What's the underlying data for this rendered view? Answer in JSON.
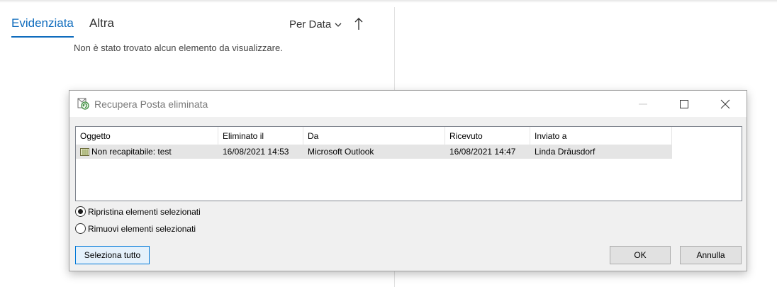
{
  "tabs": {
    "featured": "Evidenziata",
    "other": "Altra"
  },
  "sort": {
    "label": "Per Data"
  },
  "empty_message": "Non è stato trovato alcun elemento da visualizzare.",
  "dialog": {
    "title": "Recupera Posta eliminata",
    "columns": [
      "Oggetto",
      "Eliminato il",
      "Da",
      "Ricevuto",
      "Inviato a"
    ],
    "rows": [
      {
        "subject": "Non recapitabile: test",
        "deleted_on": "16/08/2021 14:53",
        "from": "Microsoft Outlook",
        "received": "16/08/2021 14:47",
        "sent_to": "Linda Dräusdorf"
      }
    ],
    "options": {
      "restore": "Ripristina elementi selezionati",
      "remove": "Rimuovi elementi selezionati",
      "selected": "restore"
    },
    "buttons": {
      "select_all": "Seleziona tutto",
      "ok": "OK",
      "cancel": "Annulla"
    }
  },
  "colors": {
    "accent": "#0f6cbd",
    "row_selected": "#e5e5e5",
    "button_focus_border": "#0078d7"
  }
}
